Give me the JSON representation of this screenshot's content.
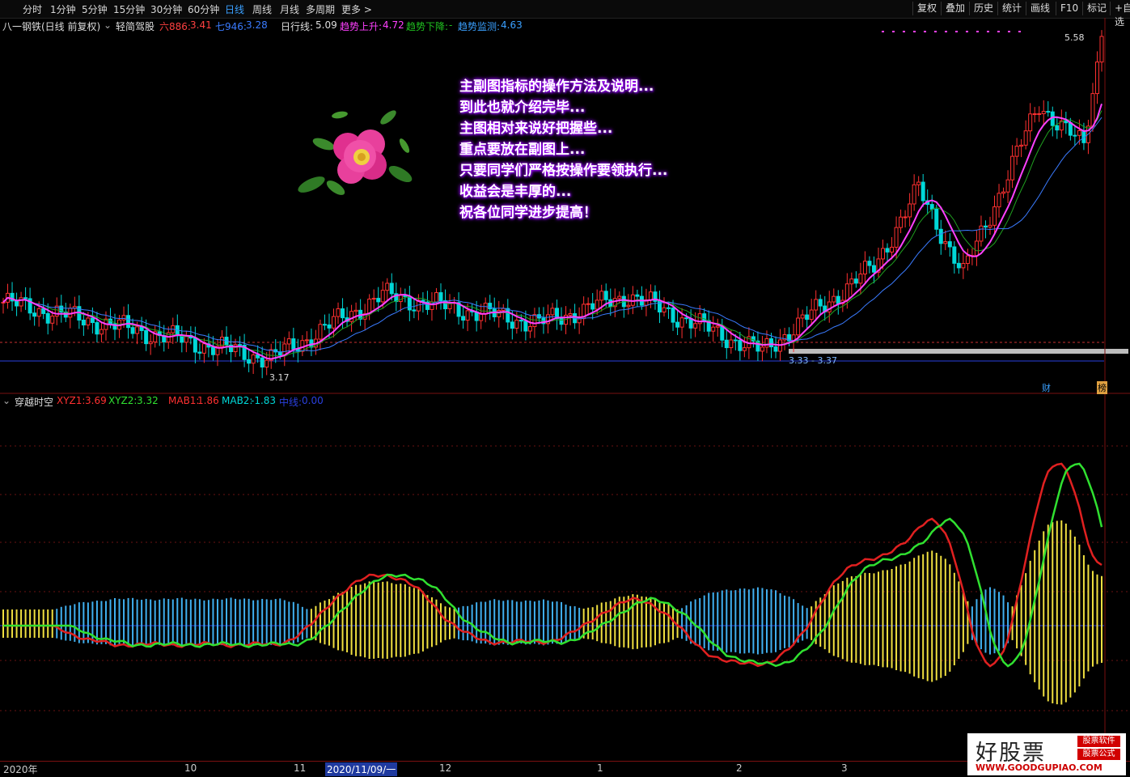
{
  "toolbar": {
    "periods": [
      "分时",
      "1分钟",
      "5分钟",
      "15分钟",
      "30分钟",
      "60分钟",
      "日线",
      "周线",
      "月线",
      "多周期",
      "更多 >"
    ],
    "active_period": "日线",
    "right_buttons": [
      "复权",
      "叠加",
      "历史",
      "统计",
      "画线",
      "F10",
      "标记",
      "+自选"
    ]
  },
  "main_header": {
    "stock": "八一钢铁(日线 前复权)",
    "indicator": "轻简驾股",
    "ma6_label": "六886:",
    "ma6_value": "3.41",
    "ma7_label": "七946:",
    "ma7_value": "3.28",
    "daily_label": "日行线:",
    "daily_value": "5.09",
    "up_label": "趋势上升:",
    "up_value": "4.72",
    "down_label": "趋势下降:",
    "down_value": "-",
    "monitor_label": "趋势监测:",
    "monitor_value": "4.63"
  },
  "annotation": {
    "lines": [
      "主副图指标的操作方法及说明...",
      "到此也就介绍完毕...",
      "主图相对来说好把握些...",
      "重点要放在副图上...",
      "只要同学们严格按操作要领执行...",
      "收益会是丰厚的...",
      "祝各位同学进步提高！"
    ]
  },
  "price_labels": {
    "high": "5.58",
    "low": "3.17",
    "range": "3.33 - 3.37"
  },
  "markers": {
    "cai": "财",
    "bang": "榜"
  },
  "sub_header": {
    "name": "穿越时空",
    "xyz1_label": "XYZ1:",
    "xyz1_value": "3.69",
    "xyz2_label": "XYZ2:",
    "xyz2_value": "3.32",
    "mab1_label": "MAB1:",
    "mab1_value": "1.86",
    "mab2_label": "MAB2:",
    "mab2_value": "-1.83",
    "mid_label": "中线:",
    "mid_value": "0.00"
  },
  "x_axis": [
    {
      "label": "2020年"
    },
    {
      "label": "10"
    },
    {
      "label": "11"
    },
    {
      "label": "2020/11/09/一"
    },
    {
      "label": "12"
    },
    {
      "label": "1"
    },
    {
      "label": "2"
    },
    {
      "label": "3"
    }
  ],
  "logo": {
    "main": "好股票",
    "url": "WWW.GOODGUPIAO.COM",
    "tag1": "股票软件",
    "tag2": "股票公式"
  },
  "colors": {
    "up": "#ff3030",
    "down": "#00d8d8",
    "ma_magenta": "#ff40ff",
    "ma_blue": "#3a7bff",
    "ma_green": "#20a020",
    "xyz1": "#e02020",
    "xyz2": "#30e030",
    "bar_pos": "#f0e040",
    "bar_neg": "#40b0f0"
  },
  "chart_data": {
    "type": "candlestick",
    "stock": "八一钢铁",
    "period": "日线",
    "y_labels": {
      "max": 5.58,
      "min": 3.17
    },
    "segments": [
      {
        "from": 0,
        "to": 60,
        "start_price": 3.7,
        "end_price": 3.3
      },
      {
        "from": 60,
        "to": 85,
        "start_price": 3.3,
        "end_price": 3.75
      },
      {
        "from": 85,
        "to": 120,
        "start_price": 3.75,
        "end_price": 3.55
      },
      {
        "from": 120,
        "to": 140,
        "start_price": 3.55,
        "end_price": 3.75
      },
      {
        "from": 140,
        "to": 170,
        "start_price": 3.75,
        "end_price": 3.35
      },
      {
        "from": 170,
        "to": 195,
        "start_price": 3.35,
        "end_price": 3.95
      },
      {
        "from": 195,
        "to": 205,
        "start_price": 3.95,
        "end_price": 4.5
      },
      {
        "from": 205,
        "to": 215,
        "start_price": 4.5,
        "end_price": 3.9
      },
      {
        "from": 215,
        "to": 232,
        "start_price": 3.9,
        "end_price": 5.1
      },
      {
        "from": 232,
        "to": 242,
        "start_price": 5.1,
        "end_price": 4.8
      },
      {
        "from": 242,
        "to": 246,
        "start_price": 4.8,
        "end_price": 5.58
      }
    ],
    "sub_indicator": {
      "name": "穿越时空",
      "series": [
        {
          "name": "XYZ1",
          "last": 3.69
        },
        {
          "name": "XYZ2",
          "last": 3.32
        },
        {
          "name": "MAB1",
          "last": 1.86
        },
        {
          "name": "MAB2",
          "last": -1.83
        },
        {
          "name": "中线",
          "last": 0.0
        }
      ]
    }
  }
}
